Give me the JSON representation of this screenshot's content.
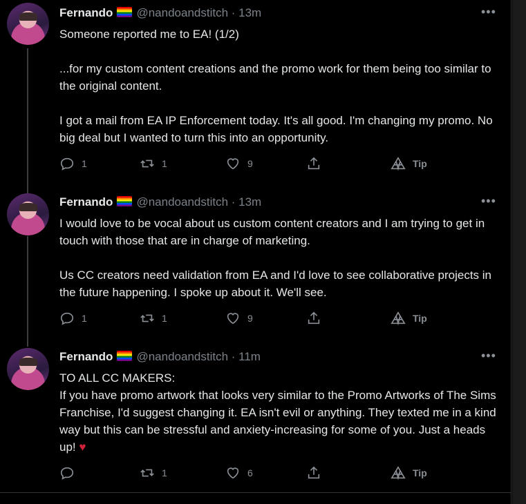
{
  "tweets": [
    {
      "name": "Fernando",
      "handle": "@nandoandstitch · 13m",
      "paragraphs": [
        "Someone reported me to EA! (1/2)",
        "...for my custom content creations and the promo work for them being too similar to the original content.",
        "I got a mail from EA IP Enforcement today. It's all good. I'm changing my promo. No big deal but I wanted to turn this into an opportunity."
      ],
      "replies": "1",
      "retweets": "1",
      "likes": "9",
      "tip": "Tip"
    },
    {
      "name": "Fernando",
      "handle": "@nandoandstitch · 13m",
      "paragraphs": [
        "I would love to be vocal about us custom content creators and I am trying to get in touch with those that are in charge of marketing.",
        "Us CC creators need validation from EA and I'd love to see collaborative projects in the future happening. I spoke up about it. We'll see."
      ],
      "replies": "1",
      "retweets": "1",
      "likes": "9",
      "tip": "Tip"
    },
    {
      "name": "Fernando",
      "handle": "@nandoandstitch · 11m",
      "paragraphs": [
        "TO ALL CC MAKERS:\nIf you have promo artwork that looks very similar to the Promo Artworks of The Sims Franchise, I'd suggest changing it. EA isn't evil or anything. They texted me in a kind way but this can be stressful and anxiety-increasing for some of you. Just a heads up!"
      ],
      "heart": "♥",
      "replies": "",
      "retweets": "1",
      "likes": "6",
      "tip": "Tip"
    }
  ],
  "more_label": "•••",
  "flag_icon": "rainbow-flag-icon"
}
